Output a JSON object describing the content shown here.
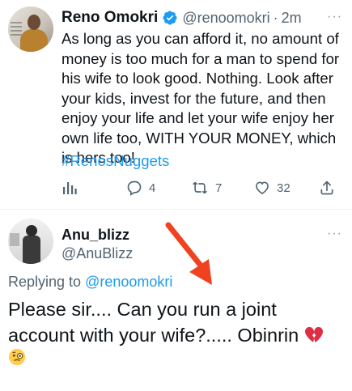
{
  "tweet": {
    "display_name": "Reno Omokri",
    "handle": "@renoomokri",
    "separator": "·",
    "time": "2m",
    "more_label": "···",
    "text": "As long as you can afford it, no amount of money is too much for a man to spend for his wife to look good. Nothing. Look after your kids, invest for the future, and then enjoy your life and let your wife enjoy her own life too, WITH YOUR MONEY, which is hers too!",
    "hashtag": "#RenosNuggets",
    "actions": {
      "analytics_icon": "bar-chart-icon",
      "reply_count": "4",
      "retweet_count": "7",
      "like_count": "32",
      "share_icon": "share-icon"
    },
    "verified_color": "#1d9bf0"
  },
  "reply": {
    "display_name": "Anu_blizz",
    "handle": "@AnuBlizz",
    "more_label": "···",
    "replying_prefix": "Replying to",
    "replying_mention": "@renoomokri",
    "text": "Please sir.... Can you run a joint account with your wife?..... Obinrin",
    "heart_emoji": "broken-heart",
    "face_emoji": "face-with-monocle"
  },
  "colors": {
    "accent": "#1d9bf0",
    "secondary_text": "#536471",
    "arrow": "#f0421e"
  }
}
